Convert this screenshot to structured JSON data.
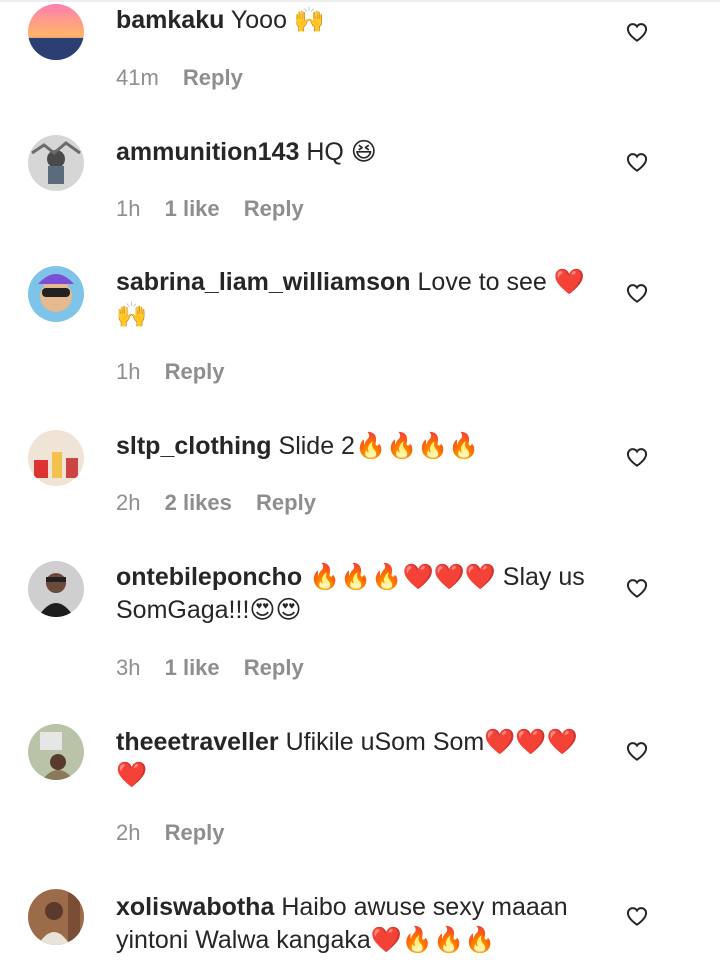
{
  "comments": [
    {
      "username": "bamkaku",
      "text": "Yooo 🙌",
      "time": "41m",
      "likes": "",
      "reply": "Reply"
    },
    {
      "username": "ammunition143",
      "text": "HQ 😆",
      "time": "1h",
      "likes": "1 like",
      "reply": "Reply"
    },
    {
      "username": "sabrina_liam_williamson",
      "text": "Love to see ❤️ 🙌",
      "time": "1h",
      "likes": "",
      "reply": "Reply"
    },
    {
      "username": "sltp_clothing",
      "text": "Slide 2🔥🔥🔥🔥",
      "time": "2h",
      "likes": "2 likes",
      "reply": "Reply"
    },
    {
      "username": "ontebileponcho",
      "text": "🔥🔥🔥❤️❤️❤️ Slay us SomGaga!!!😍😍",
      "time": "3h",
      "likes": "1 like",
      "reply": "Reply"
    },
    {
      "username": "theeetraveller",
      "text": "Ufikile uSom Som❤️❤️❤️ ❤️",
      "time": "2h",
      "likes": "",
      "reply": "Reply"
    },
    {
      "username": "xoliswabotha",
      "text": "Haibo awuse sexy maaan yintoni Walwa kangaka❤️🔥🔥🔥",
      "time": "",
      "likes": "",
      "reply": ""
    }
  ],
  "icons": {
    "avatar": "user-avatar",
    "like": "heart-outline-icon"
  },
  "colors": {
    "text": "#262626",
    "muted": "#8e8e8e"
  }
}
